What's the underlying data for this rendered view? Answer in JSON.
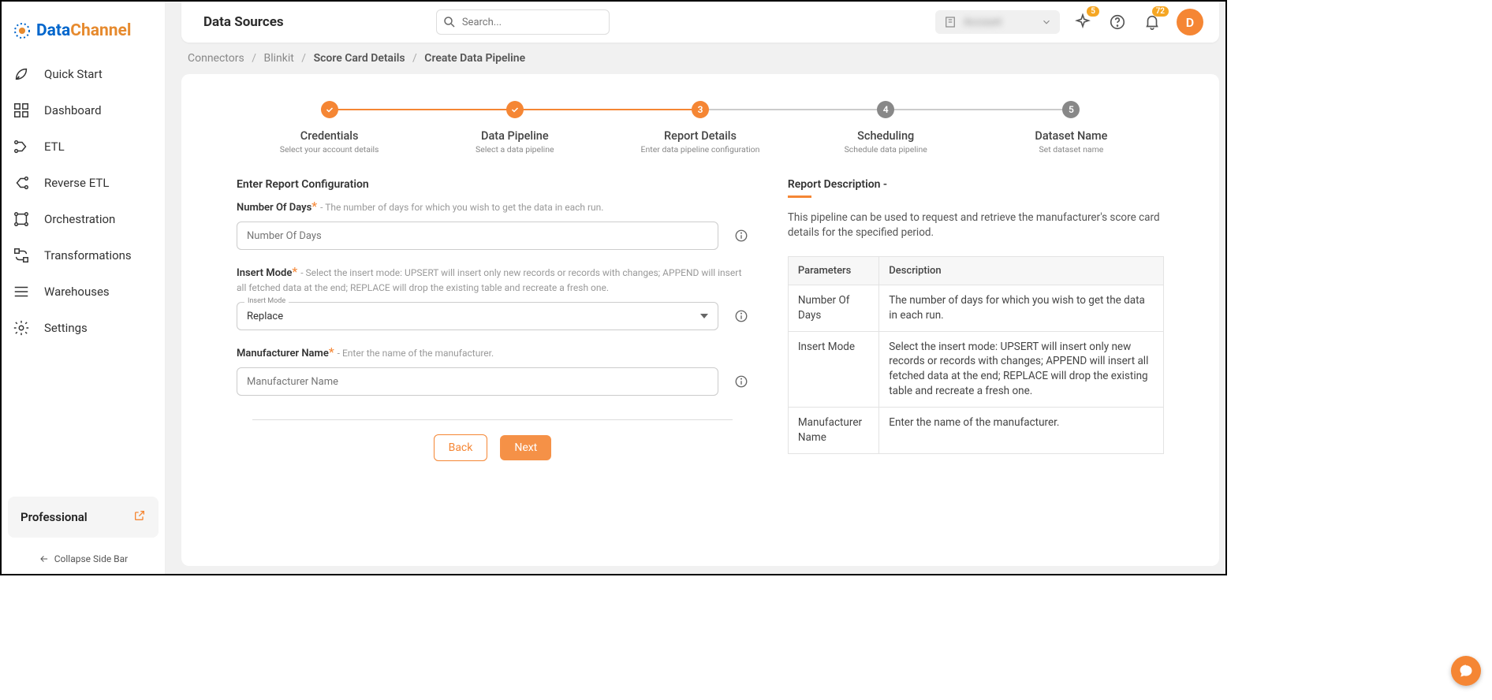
{
  "logo": {
    "p1": "Data",
    "p2": "Channel"
  },
  "sidebar": {
    "items": [
      {
        "label": "Quick Start"
      },
      {
        "label": "Dashboard"
      },
      {
        "label": "ETL"
      },
      {
        "label": "Reverse ETL"
      },
      {
        "label": "Orchestration"
      },
      {
        "label": "Transformations"
      },
      {
        "label": "Warehouses"
      },
      {
        "label": "Settings"
      }
    ],
    "plan": "Professional",
    "collapse": "Collapse Side Bar"
  },
  "topbar": {
    "title": "Data Sources",
    "search_placeholder": "Search...",
    "account_name": "Account",
    "sparkle_badge": "5",
    "bell_badge": "72",
    "avatar": "D"
  },
  "breadcrumb": {
    "a": "Connectors",
    "b": "Blinkit",
    "c": "Score Card Details",
    "d": "Create Data Pipeline"
  },
  "steps": [
    {
      "title": "Credentials",
      "sub": "Select your account details"
    },
    {
      "title": "Data Pipeline",
      "sub": "Select a data pipeline"
    },
    {
      "title": "Report Details",
      "sub": "Enter data pipeline configuration",
      "num": "3"
    },
    {
      "title": "Scheduling",
      "sub": "Schedule data pipeline",
      "num": "4"
    },
    {
      "title": "Dataset Name",
      "sub": "Set dataset name",
      "num": "5"
    }
  ],
  "form": {
    "heading": "Enter Report Configuration",
    "fields": {
      "days": {
        "label": "Number Of Days",
        "hint": "- The number of days for which you wish to get the data in each run.",
        "placeholder": "Number Of Days"
      },
      "insert": {
        "label": "Insert Mode",
        "hint": "- Select the insert mode: UPSERT will insert only new records or records with changes; APPEND will insert all fetched data at the end; REPLACE will drop the existing table and recreate a fresh one.",
        "float": "Insert Mode",
        "value": "Replace"
      },
      "manuf": {
        "label": "Manufacturer Name",
        "hint": "- Enter the name of the manufacturer.",
        "placeholder": "Manufacturer Name"
      }
    },
    "back": "Back",
    "next": "Next"
  },
  "description": {
    "title": "Report Description -",
    "text": "This pipeline can be used to request and retrieve the manufacturer's score card details for the specified period.",
    "th1": "Parameters",
    "th2": "Description",
    "rows": [
      {
        "p": "Number Of Days",
        "d": "The number of days for which you wish to get the data in each run."
      },
      {
        "p": "Insert Mode",
        "d": "Select the insert mode: UPSERT will insert only new records or records with changes; APPEND will insert all fetched data at the end; REPLACE will drop the existing table and recreate a fresh one."
      },
      {
        "p": "Manufacturer Name",
        "d": "Enter the name of the manufacturer."
      }
    ]
  }
}
